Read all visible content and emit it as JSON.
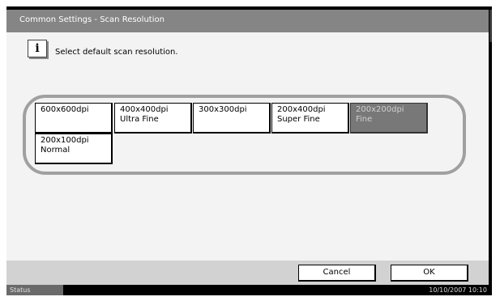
{
  "window": {
    "title": "Common Settings - Scan Resolution"
  },
  "info": {
    "icon": "info-icon",
    "message": "Select default scan resolution."
  },
  "options": [
    {
      "line1": "600x600dpi",
      "line2": "",
      "selected": false
    },
    {
      "line1": "400x400dpi",
      "line2": "Ultra Fine",
      "selected": false
    },
    {
      "line1": "300x300dpi",
      "line2": "",
      "selected": false
    },
    {
      "line1": "200x400dpi",
      "line2": "Super Fine",
      "selected": false
    },
    {
      "line1": "200x200dpi",
      "line2": "Fine",
      "selected": true
    },
    {
      "line1": "200x100dpi",
      "line2": "Normal",
      "selected": false
    }
  ],
  "buttons": {
    "cancel": "Cancel",
    "ok": "OK"
  },
  "status": {
    "label": "Status",
    "datetime": "10/10/2007   10:10"
  },
  "colors": {
    "title_bar": "#858585",
    "selected_option": "#787878",
    "group_border": "#a0a0a0",
    "bottom_bar": "#d2d2d2"
  }
}
